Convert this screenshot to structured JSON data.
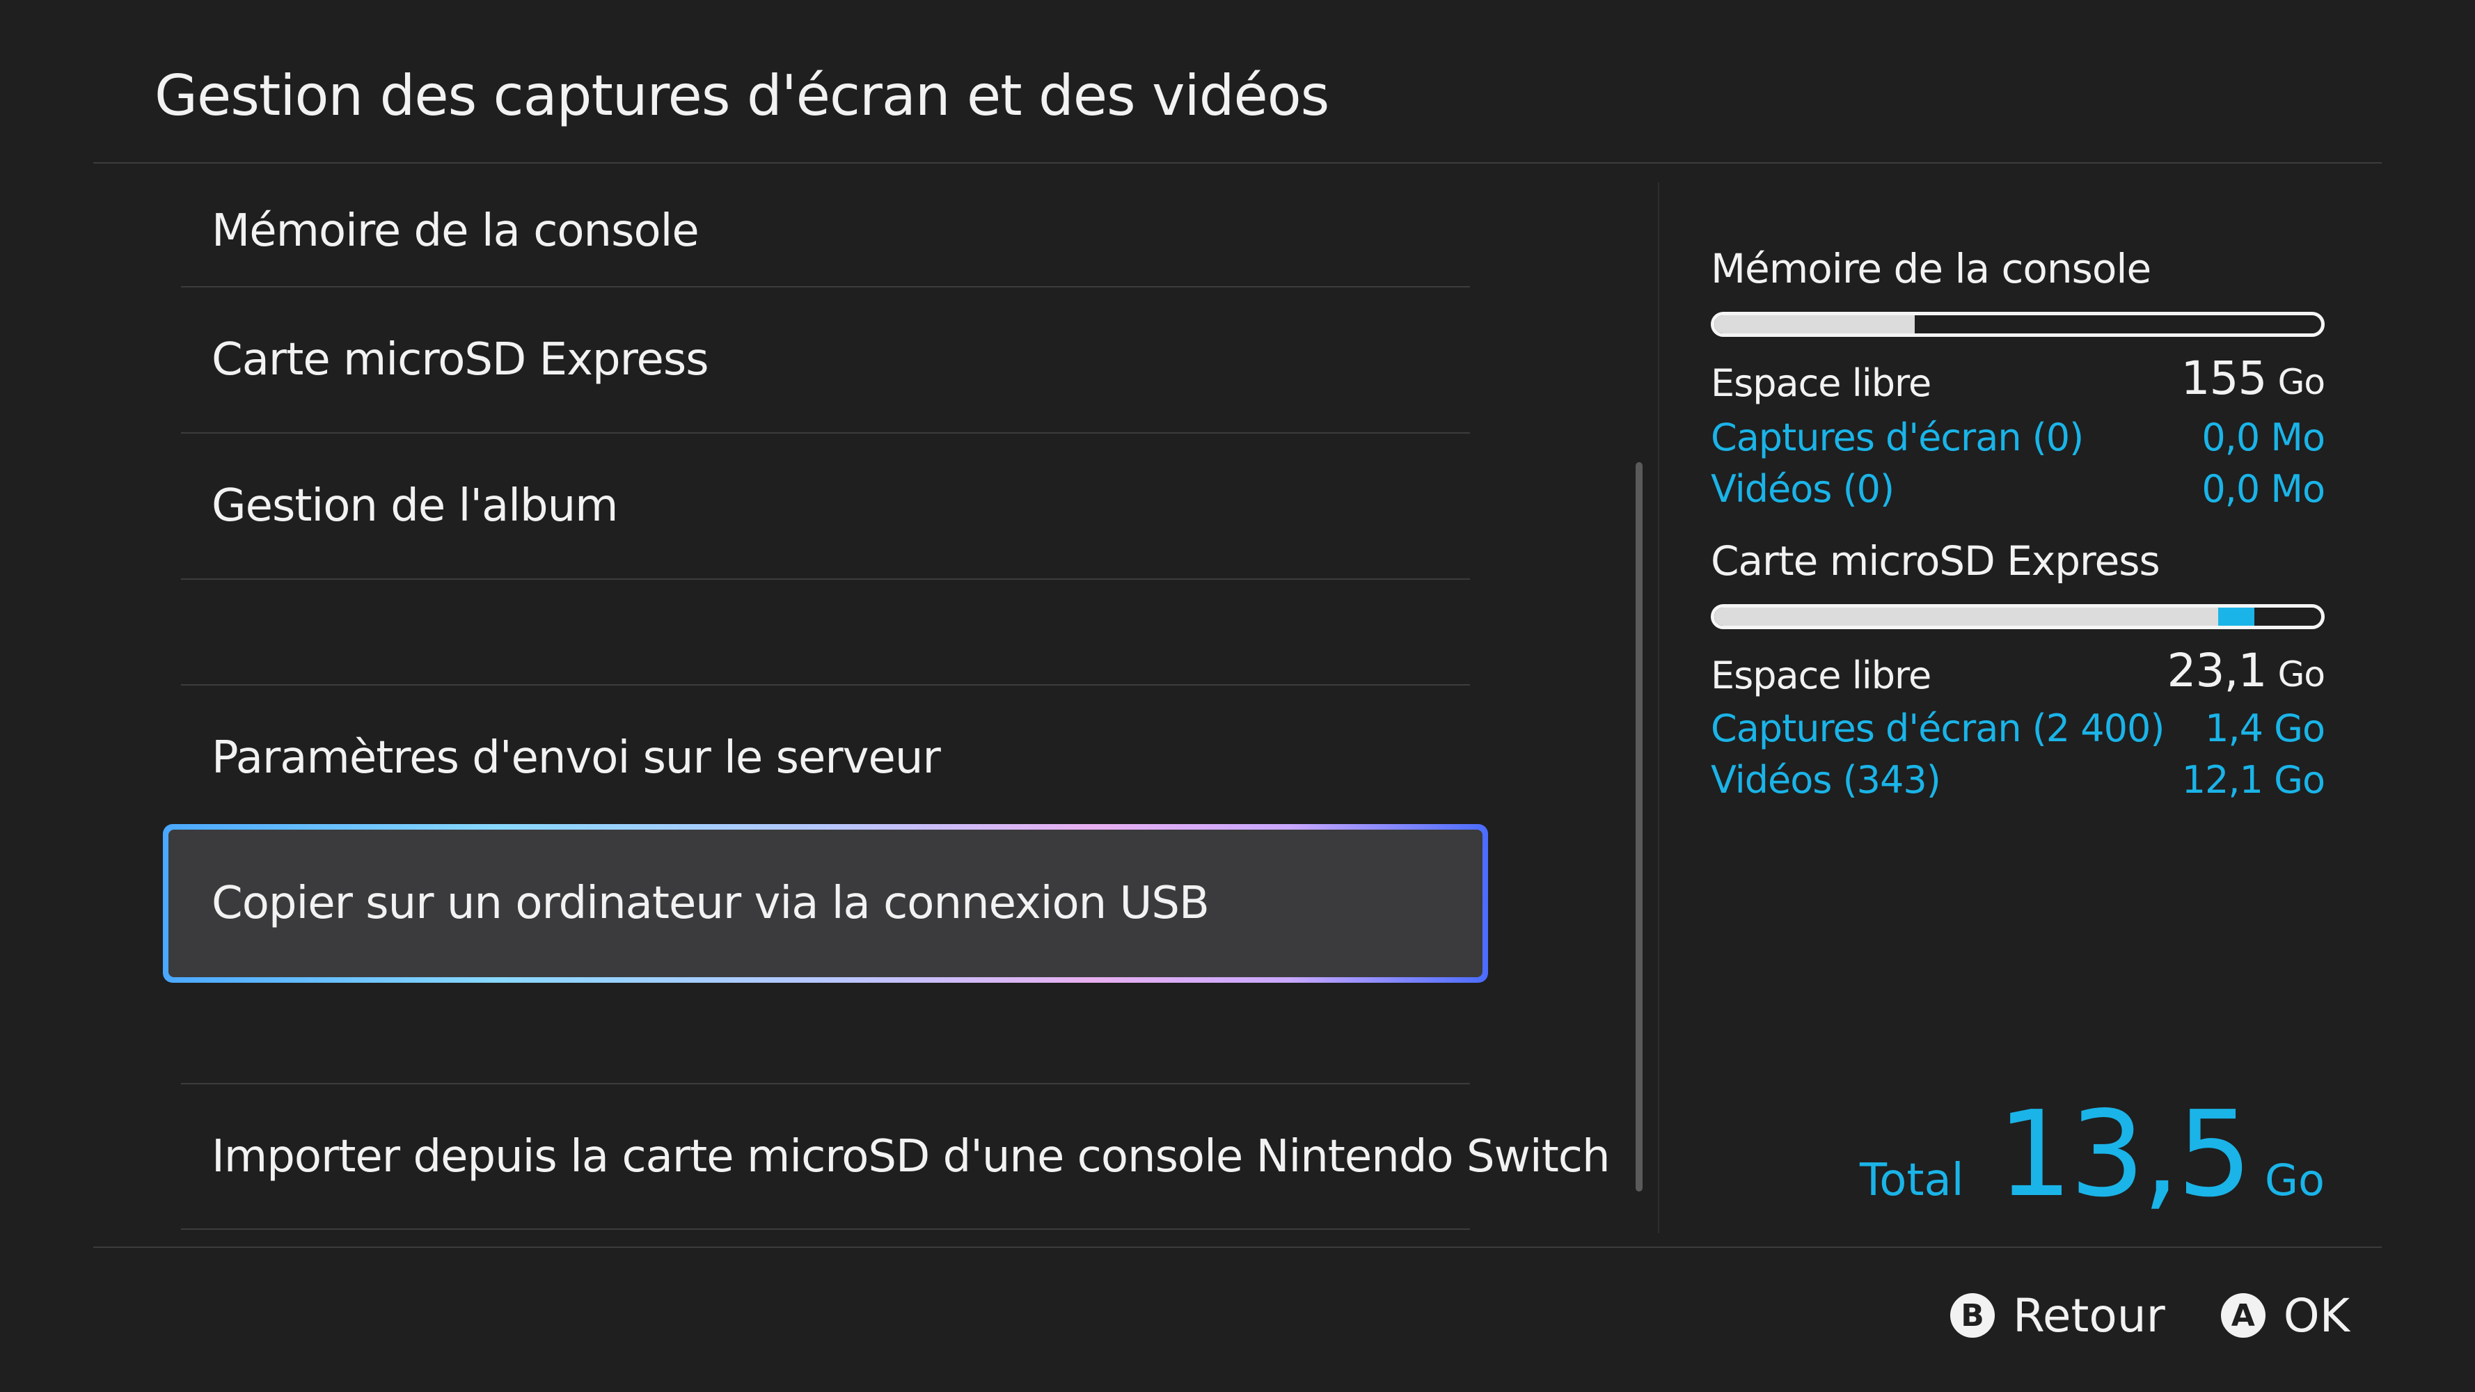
{
  "page_title": "Gestion des captures d'écran et des vidéos",
  "menu": {
    "items": [
      {
        "label": "Mémoire de la console"
      },
      {
        "label": "Carte microSD Express"
      },
      {
        "label": "Gestion de l'album"
      },
      {
        "label": ""
      },
      {
        "label": "Paramètres d'envoi sur le serveur"
      },
      {
        "label": "Copier sur un ordinateur via la connexion USB",
        "selected": true
      },
      {
        "label": ""
      },
      {
        "label": "Importer depuis la carte microSD d'une console Nintendo Switch"
      }
    ]
  },
  "storage": {
    "console": {
      "heading": "Mémoire de la console",
      "used_fraction": 0.33,
      "free_label": "Espace libre",
      "free_value": "155",
      "free_unit": "Go",
      "screenshots_label": "Captures d'écran (0)",
      "screenshots_value": "0,0 Mo",
      "videos_label": "Vidéos (0)",
      "videos_value": "0,0 Mo"
    },
    "microsd": {
      "heading": "Carte microSD Express",
      "used_fraction": 0.83,
      "album_fraction": 0.06,
      "free_label": "Espace libre",
      "free_value": "23,1",
      "free_unit": "Go",
      "screenshots_label": "Captures d'écran (2 400)",
      "screenshots_value": "1,4 Go",
      "videos_label": "Vidéos (343)",
      "videos_value": "12,1 Go"
    }
  },
  "total": {
    "label": "Total",
    "value": "13,5",
    "unit": "Go"
  },
  "footer": {
    "back_icon": "B",
    "back_label": "Retour",
    "ok_icon": "A",
    "ok_label": "OK"
  },
  "colors": {
    "background": "#1f1f1f",
    "accent": "#1ab4e8",
    "selected_background": "#3b3b3d"
  }
}
